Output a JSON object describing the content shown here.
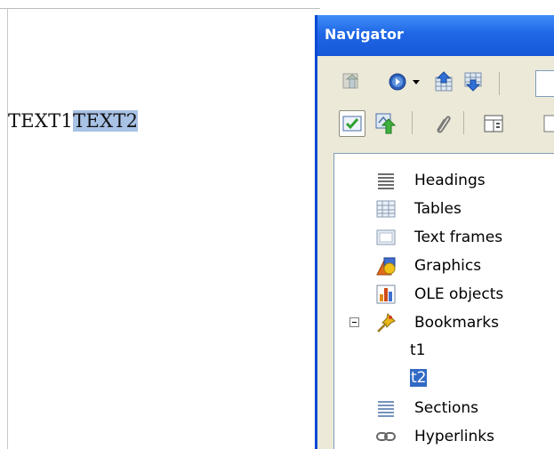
{
  "document": {
    "text_plain": "TEXT1",
    "text_selected": "TEXT2"
  },
  "navigator": {
    "title": "Navigator",
    "toolbar_row1": [
      {
        "icon": "toggle-content-icon"
      },
      {
        "icon": "navigation-icon"
      },
      {
        "icon": "dropdown-arrow-icon"
      },
      {
        "icon": "previous-icon"
      },
      {
        "icon": "next-icon"
      }
    ],
    "toolbar_row2": [
      {
        "icon": "content-view-icon",
        "pressed": true
      },
      {
        "icon": "drag-mode-icon"
      },
      {
        "icon": "reminder-icon"
      },
      {
        "icon": "headings-icon"
      }
    ],
    "tree": {
      "categories": [
        {
          "label": "Headings",
          "icon": "headings-icon"
        },
        {
          "label": "Tables",
          "icon": "tables-icon"
        },
        {
          "label": "Text frames",
          "icon": "text-frames-icon"
        },
        {
          "label": "Graphics",
          "icon": "graphics-icon"
        },
        {
          "label": "OLE objects",
          "icon": "ole-objects-icon"
        },
        {
          "label": "Bookmarks",
          "icon": "bookmarks-icon",
          "expanded": true
        },
        {
          "label": "Sections",
          "icon": "sections-icon"
        },
        {
          "label": "Hyperlinks",
          "icon": "hyperlinks-icon"
        }
      ],
      "bookmarks": [
        {
          "label": "t1",
          "selected": false
        },
        {
          "label": "t2",
          "selected": true
        }
      ]
    }
  },
  "colors": {
    "titlebar": "#1f67e6",
    "selection_doc": "#a8c2e6",
    "selection_tree": "#316ac5"
  }
}
